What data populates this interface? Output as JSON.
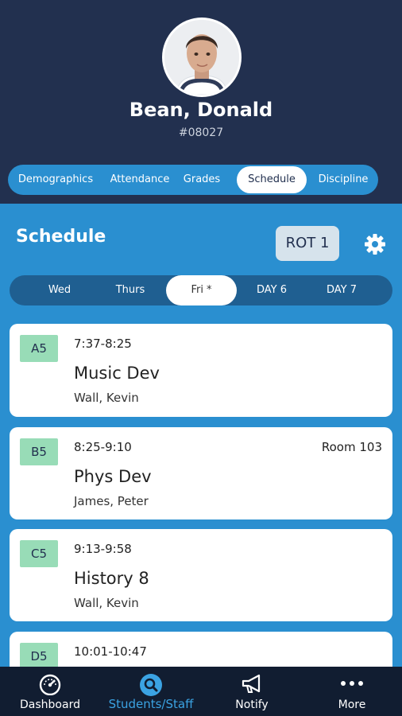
{
  "student": {
    "name": "Bean, Donald",
    "id": "#08027"
  },
  "tabs": [
    {
      "label": "Demographics"
    },
    {
      "label": "Attendance"
    },
    {
      "label": "Grades"
    },
    {
      "label": "Schedule",
      "active": true
    },
    {
      "label": "Discipline"
    }
  ],
  "schedule": {
    "title": "Schedule",
    "rotation_label": "ROT 1",
    "settings_icon": "gear-icon",
    "days": [
      {
        "label": "Wed"
      },
      {
        "label": "Thurs"
      },
      {
        "label": "Fri *",
        "active": true
      },
      {
        "label": "DAY 6"
      },
      {
        "label": "DAY 7"
      }
    ],
    "classes": [
      {
        "block": "A5",
        "time": "7:37-8:25",
        "room": "",
        "course": "Music Dev",
        "teacher": "Wall, Kevin"
      },
      {
        "block": "B5",
        "time": "8:25-9:10",
        "room": "Room 103",
        "course": "Phys Dev",
        "teacher": "James, Peter"
      },
      {
        "block": "C5",
        "time": "9:13-9:58",
        "room": "",
        "course": "History 8",
        "teacher": "Wall, Kevin"
      },
      {
        "block": "D5",
        "time": "10:01-10:47",
        "room": "",
        "course": "",
        "teacher": ""
      }
    ]
  },
  "bottom_nav": [
    {
      "label": "Dashboard",
      "icon": "speedometer-icon"
    },
    {
      "label": "Students/Staff",
      "icon": "search-icon",
      "active": true
    },
    {
      "label": "Notify",
      "icon": "megaphone-icon"
    },
    {
      "label": "More",
      "icon": "ellipsis-icon"
    }
  ],
  "colors": {
    "header_bg": "#22304f",
    "content_bg": "#2a8fd0",
    "block_badge": "#98dcb7",
    "nav_bg": "#111d31",
    "nav_active": "#3ba3e3"
  }
}
